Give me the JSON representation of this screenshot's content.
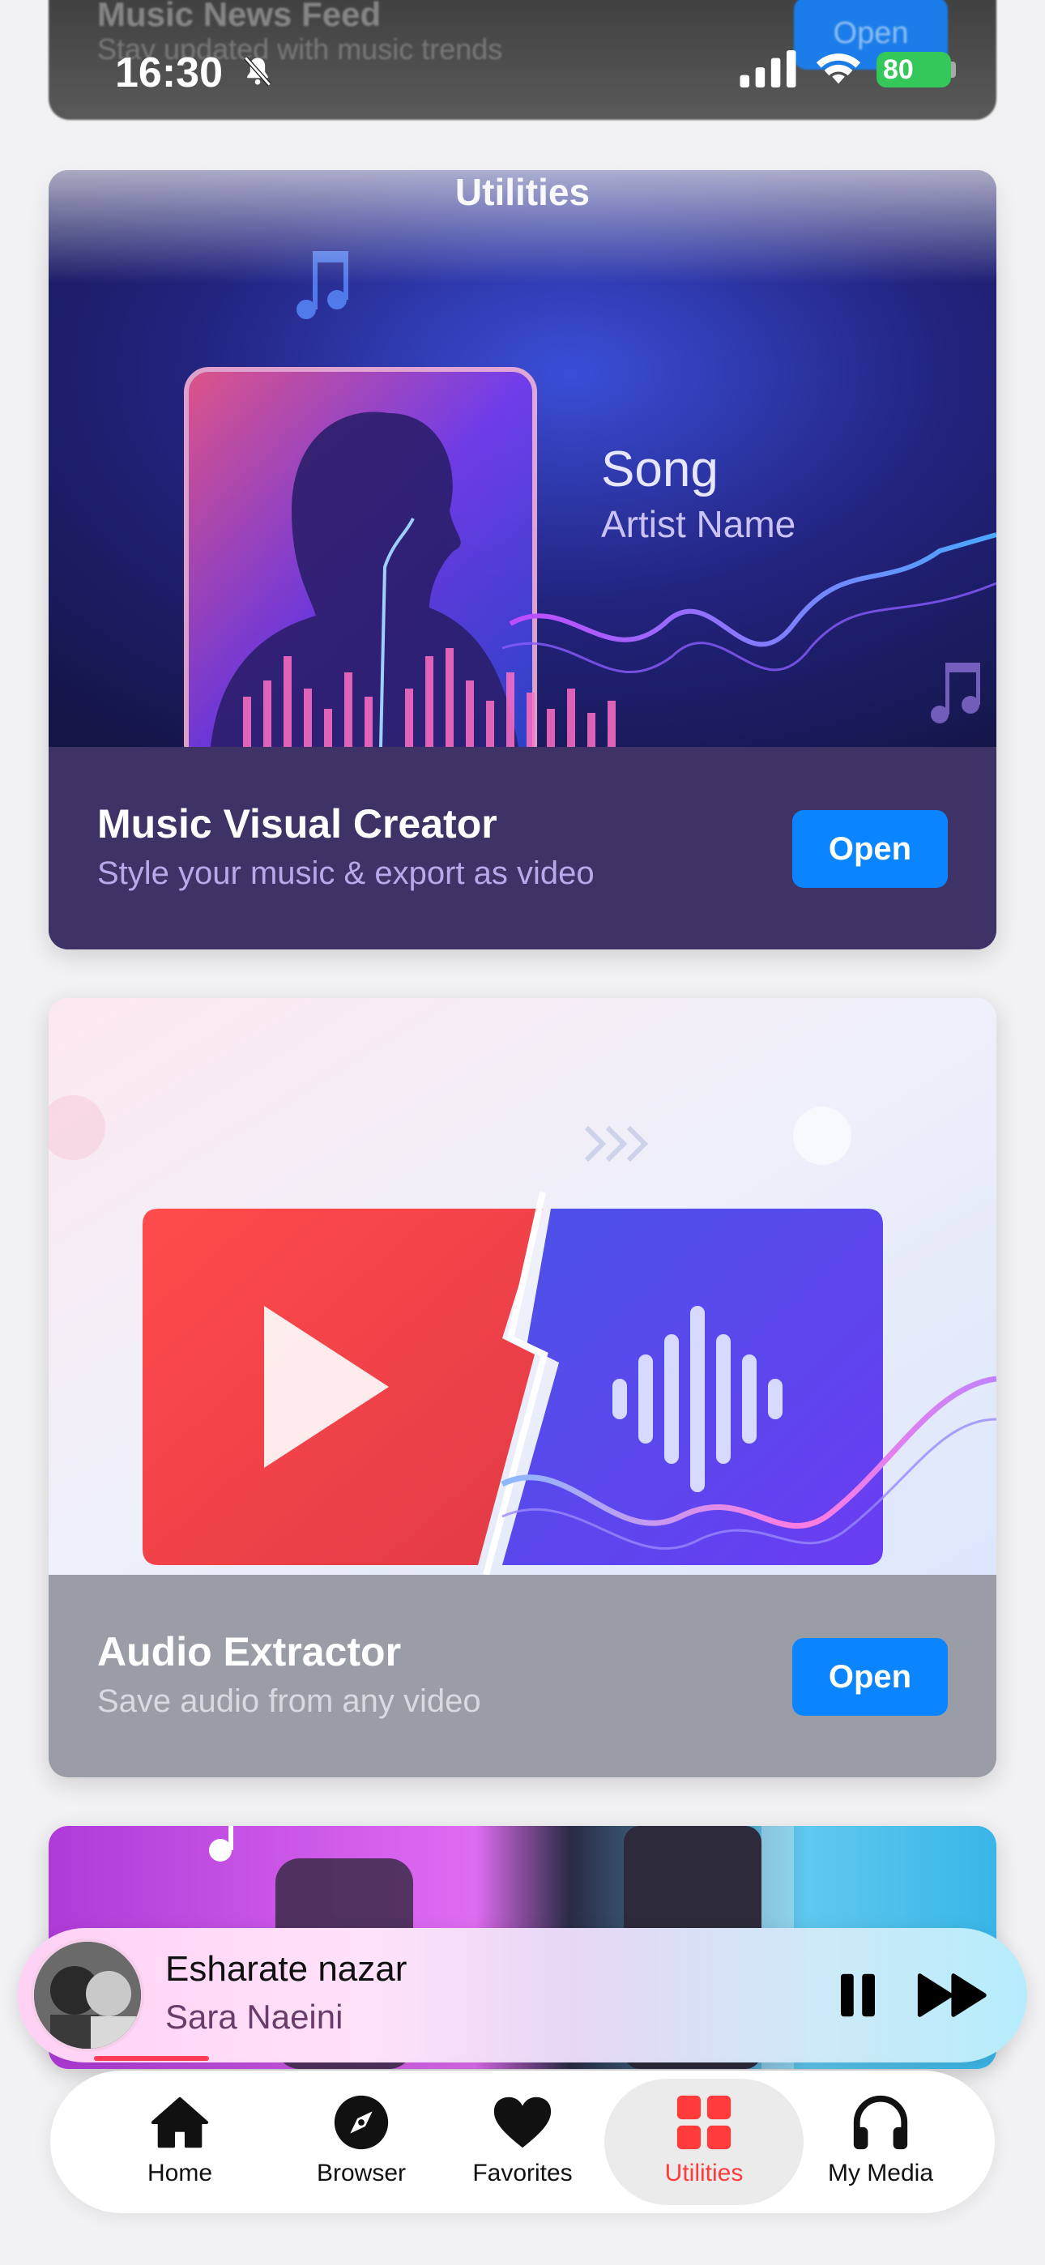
{
  "status_bar": {
    "time": "16:30",
    "battery": "80"
  },
  "page": {
    "title": "Utilities"
  },
  "ghost_card": {
    "title": "Music News Feed",
    "subtitle": "Stay updated with music trends",
    "button": "Open"
  },
  "cards": [
    {
      "title": "Music Visual Creator",
      "subtitle": "Style your music & export as video",
      "button": "Open",
      "preview": {
        "song": "Song",
        "artist": "Artist Name"
      }
    },
    {
      "title": "Audio Extractor",
      "subtitle": "Save audio from any video",
      "button": "Open"
    }
  ],
  "player": {
    "track": "Esharate nazar",
    "artist": "Sara Naeini",
    "progress": 0.11
  },
  "tabs": [
    {
      "label": "Home",
      "icon": "house-icon"
    },
    {
      "label": "Browser",
      "icon": "compass-icon"
    },
    {
      "label": "Favorites",
      "icon": "heart-icon"
    },
    {
      "label": "Utilities",
      "icon": "grid-icon",
      "active": true
    },
    {
      "label": "My Media",
      "icon": "headphones-icon"
    }
  ],
  "colors": {
    "accent": "#0a84ff",
    "active_tab": "#ff3b3b",
    "battery": "#34c759"
  }
}
